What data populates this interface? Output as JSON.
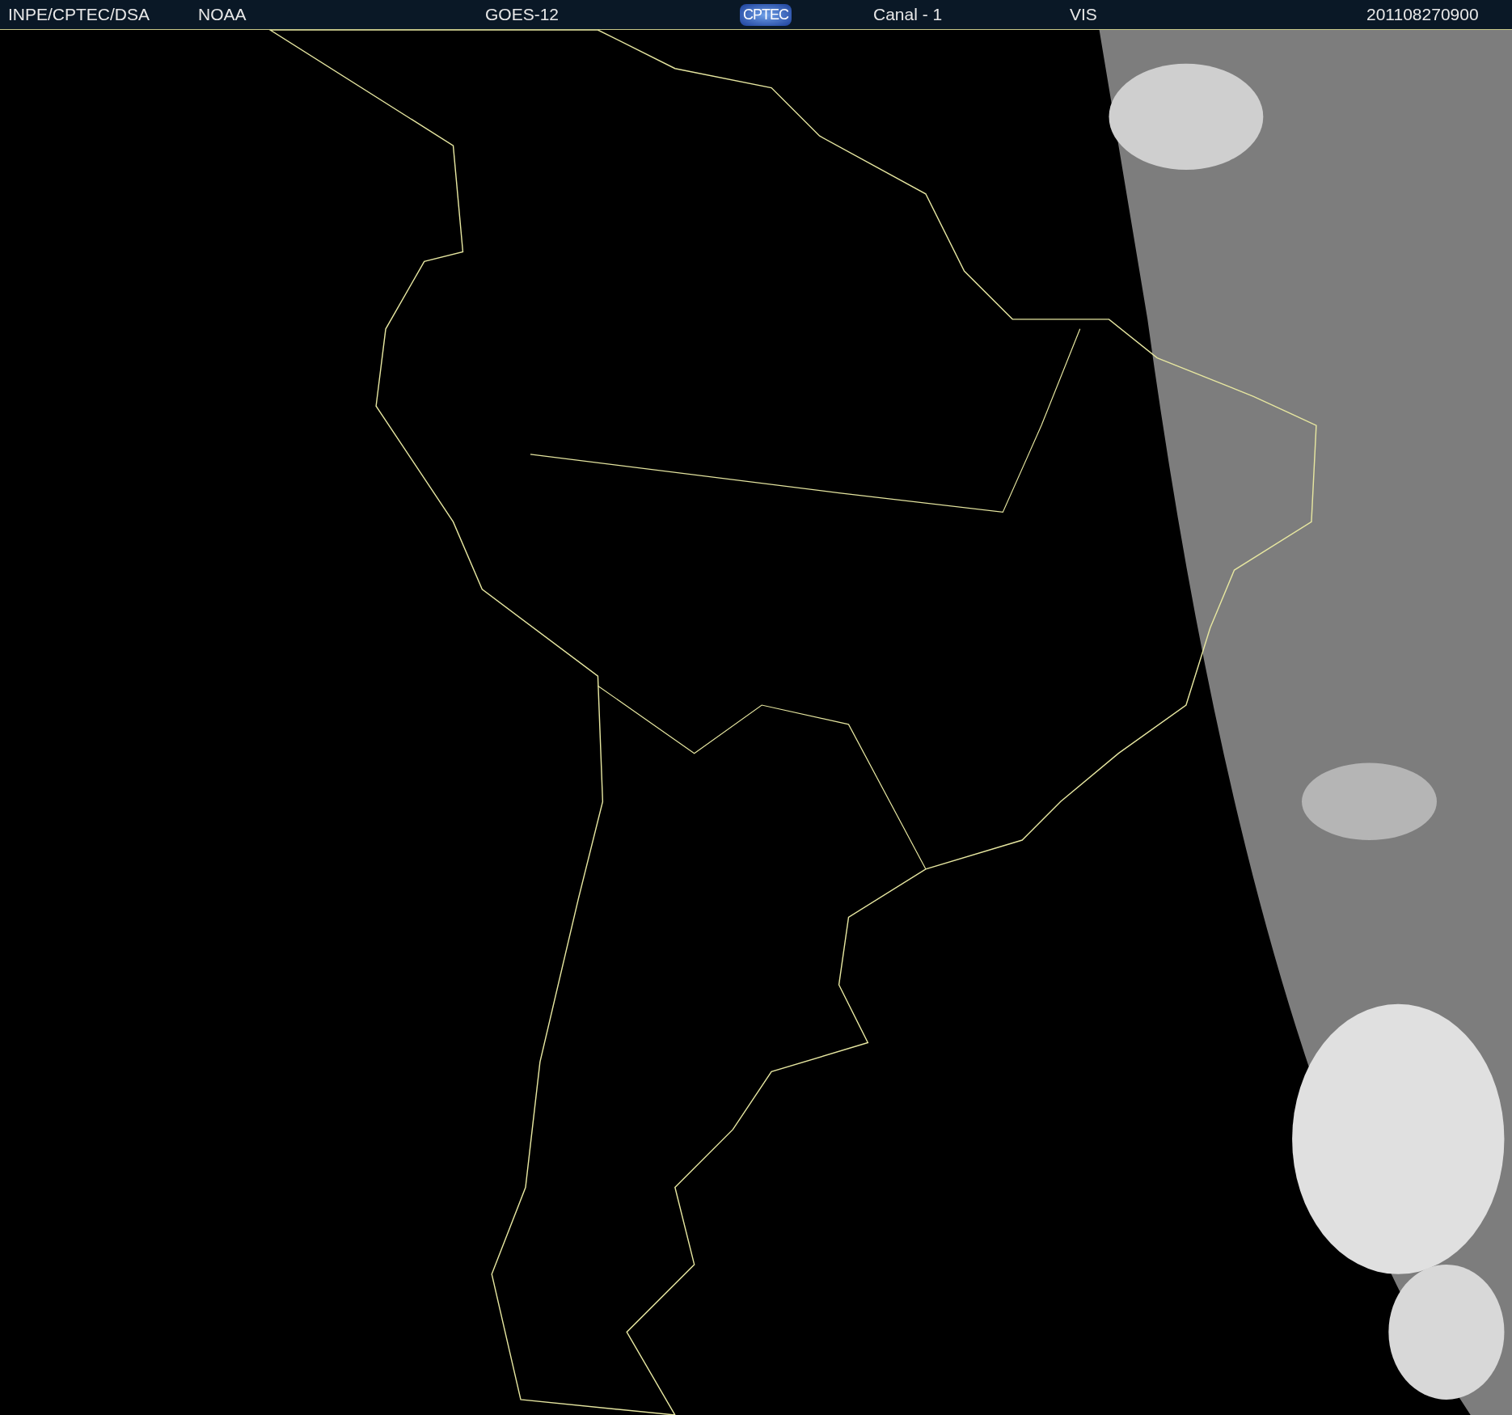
{
  "header": {
    "source": "INPE/CPTEC/DSA",
    "agency": "NOAA",
    "satellite": "GOES-12",
    "logo": "CPTEC",
    "channel": "Canal - 1",
    "band": "VIS",
    "timestamp": "201108270900"
  }
}
